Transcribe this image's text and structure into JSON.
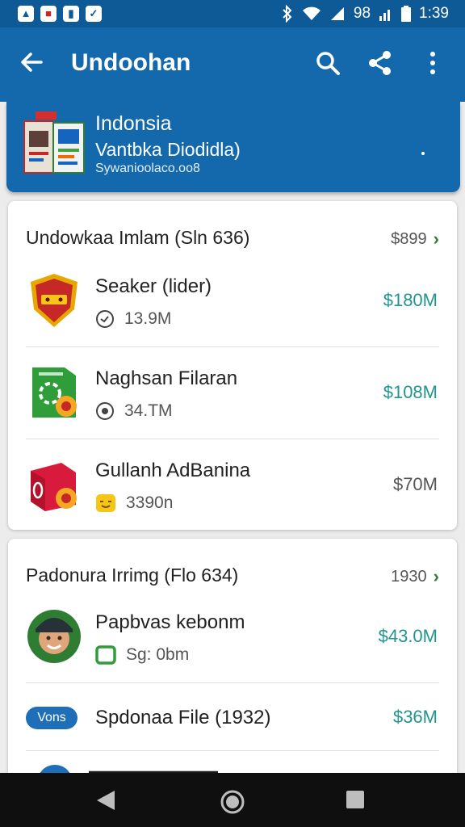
{
  "status_bar": {
    "time": "1:39",
    "battery_text": "98"
  },
  "app_bar": {
    "title": "Undoohan"
  },
  "header": {
    "title": "Indonsia",
    "subtitle": "Vantbka Diodidla)",
    "small": "Sywanioolaco.oo8"
  },
  "sections": [
    {
      "title": "Undowkaa Imlam (Sln 636)",
      "side": "$899",
      "items": [
        {
          "name": "Seaker (lider)",
          "meta": "13.9M",
          "price": "$180M"
        },
        {
          "name": "Naghsan Filaran",
          "meta": "34.TM",
          "price": "$108M"
        },
        {
          "name": "Gullanh AdBanina",
          "meta": "3390n",
          "price": "$70M"
        }
      ]
    },
    {
      "title": "Padonura Irrimg (Flo 634)",
      "side": "1930",
      "items": [
        {
          "name": "Papbvas kebonm",
          "meta": "Sg: 0bm",
          "price": "$43.0M"
        },
        {
          "chip": "Vons",
          "name": "Spdonaa File (1932)",
          "price": "$36M"
        }
      ]
    }
  ],
  "colors": {
    "primary": "#1469ad",
    "status": "#0d5a96",
    "price": "#22948e",
    "chevron": "#2e7d32"
  }
}
